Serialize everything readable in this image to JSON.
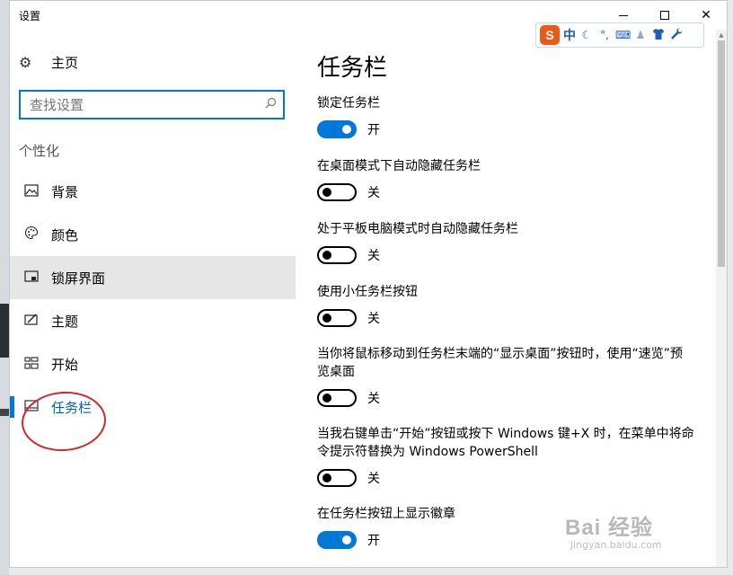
{
  "window": {
    "title": "设置",
    "minimize": "—",
    "maximize": "☐",
    "close": "✕"
  },
  "sidebar": {
    "home_label": "主页",
    "search_placeholder": "查找设置",
    "group_label": "个性化",
    "items": [
      {
        "label": "背景",
        "icon": "picture-icon"
      },
      {
        "label": "颜色",
        "icon": "palette-icon"
      },
      {
        "label": "锁屏界面",
        "icon": "lock-screen-icon"
      },
      {
        "label": "主题",
        "icon": "theme-icon"
      },
      {
        "label": "开始",
        "icon": "start-icon"
      },
      {
        "label": "任务栏",
        "icon": "taskbar-icon"
      }
    ],
    "hovered": "锁屏界面",
    "selected": "任务栏"
  },
  "content": {
    "title": "任务栏",
    "settings": [
      {
        "label": "锁定任务栏",
        "on": true,
        "state": "开"
      },
      {
        "label": "在桌面模式下自动隐藏任务栏",
        "on": false,
        "state": "关"
      },
      {
        "label": "处于平板电脑模式时自动隐藏任务栏",
        "on": false,
        "state": "关"
      },
      {
        "label": "使用小任务栏按钮",
        "on": false,
        "state": "关"
      },
      {
        "label": "当你将鼠标移动到任务栏末端的“显示桌面”按钮时，使用“速览”预览桌面",
        "on": false,
        "state": "关"
      },
      {
        "label": "当我右键单击“开始”按钮或按下 Windows 键+X 时，在菜单中将命令提示符替换为 Windows PowerShell",
        "on": false,
        "state": "关"
      },
      {
        "label": "在任务栏按钮上显示徽章",
        "on": true,
        "state": "开"
      }
    ]
  },
  "ime": {
    "logo": "S",
    "mode": "中"
  },
  "watermark": {
    "text": "Bai  经验",
    "url": "jingyan.baidu.com"
  },
  "colors": {
    "accent": "#0078d7",
    "annotation": "#d2262e"
  }
}
